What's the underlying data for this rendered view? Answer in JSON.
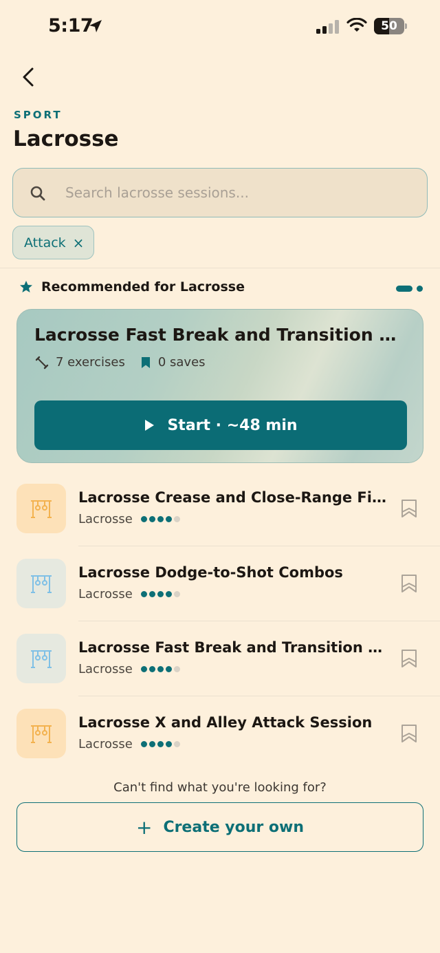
{
  "status_bar": {
    "time": "5:17",
    "battery": "50",
    "battery_level": 0.5
  },
  "header": {
    "eyebrow": "SPORT",
    "title": "Lacrosse"
  },
  "search": {
    "placeholder": "Search lacrosse sessions..."
  },
  "filters": [
    {
      "label": "Attack"
    }
  ],
  "recommended": {
    "heading": "Recommended for Lacrosse",
    "card": {
      "title": "Lacrosse Fast Break and Transition Attack",
      "exercises": "7 exercises",
      "saves": "0 saves",
      "start_label": "Start · ~48 min"
    }
  },
  "sessions": [
    {
      "title": "Lacrosse Crease and Close-Range Finishing",
      "sport": "Lacrosse",
      "difficulty": 4,
      "difficulty_max": 5,
      "thumb_icon": "rings-icon",
      "thumb_color": "orange"
    },
    {
      "title": "Lacrosse Dodge-to-Shot Combos",
      "sport": "Lacrosse",
      "difficulty": 4,
      "difficulty_max": 5,
      "thumb_icon": "rings-icon",
      "thumb_color": "blue"
    },
    {
      "title": "Lacrosse Fast Break and Transition Attack",
      "sport": "Lacrosse",
      "difficulty": 4,
      "difficulty_max": 5,
      "thumb_icon": "rings-icon",
      "thumb_color": "blue"
    },
    {
      "title": "Lacrosse X and Alley Attack Session",
      "sport": "Lacrosse",
      "difficulty": 4,
      "difficulty_max": 5,
      "thumb_icon": "rings-icon",
      "thumb_color": "orange"
    }
  ],
  "footer": {
    "question": "Can't find what you're looking for?",
    "create_label": "Create your own"
  },
  "colors": {
    "accent": "#0d6f76",
    "background": "#fdf0dc",
    "thumb_orange": "#fde1b8",
    "thumb_blue": "#e6e9e0"
  }
}
